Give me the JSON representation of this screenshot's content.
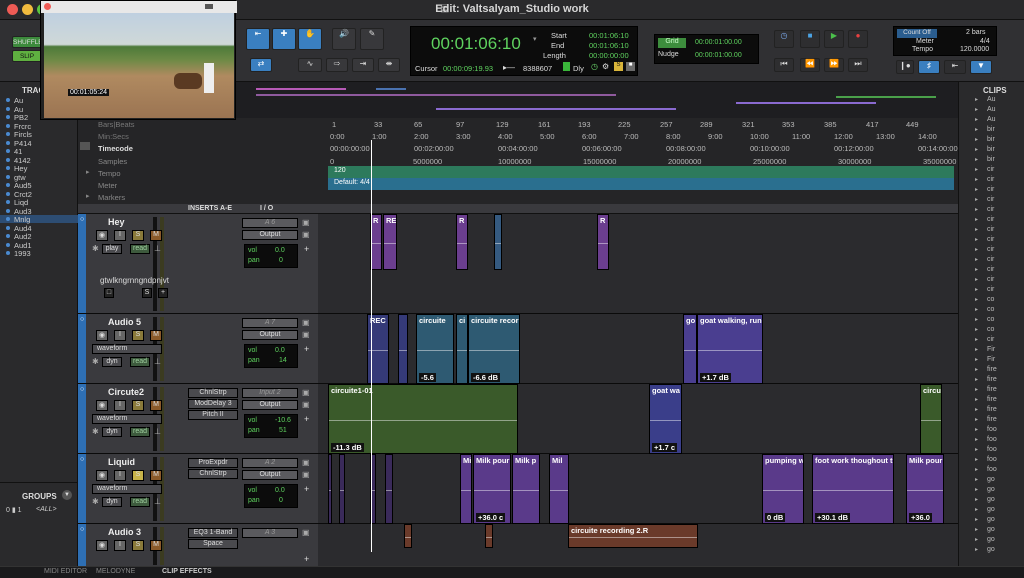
{
  "window": {
    "title": "Edit: Valtsalyam_Studio work"
  },
  "toolbar": {
    "shuffle": "SHUFFLE",
    "slip": "SLIP",
    "main_counter": "00:01:06:10",
    "start_label": "Start",
    "end_label": "End",
    "length_label": "Length",
    "start": "00:01:06:10",
    "end": "00:01:06:10",
    "length": "00:00:00:00",
    "cursor_label": "Cursor",
    "cursor": "00:00:09:19.93",
    "samples": "8388607",
    "dly": "Dly",
    "grid_label": "Grid",
    "nudge_label": "Nudge",
    "grid": "00:00:01:00.00",
    "nudge": "00:00:01:00.00",
    "count_off": "Count Off",
    "meter_label": "Meter",
    "tempo_label": "Tempo",
    "bars": "2 bars",
    "meter": "4/4",
    "tempo": "120.0000"
  },
  "video": {
    "timecode": "00:01:05:24"
  },
  "rulers": {
    "bars_beats": "Bars|Beats",
    "min_secs": "Min:Secs",
    "timecode": "Timecode",
    "samples": "Samples",
    "tempo": "Tempo",
    "meter": "Meter",
    "markers": "Markers",
    "tempo_value": "120",
    "meter_value": "Default: 4/4",
    "bars_ticks": [
      "1",
      "33",
      "65",
      "97",
      "129",
      "161",
      "193",
      "225",
      "257",
      "289",
      "321",
      "353",
      "385",
      "417",
      "449"
    ],
    "min_ticks": [
      "0:00",
      "1:00",
      "2:00",
      "3:00",
      "4:00",
      "5:00",
      "6:00",
      "7:00",
      "8:00",
      "9:00",
      "10:00",
      "11:00",
      "12:00",
      "13:00",
      "14:00"
    ],
    "tc_ticks": [
      "00:00:00:00",
      "00:02:00:00",
      "00:04:00:00",
      "00:06:00:00",
      "00:08:00:00",
      "00:10:00:00",
      "00:12:00:00",
      "00:14:00:00"
    ],
    "sample_ticks": [
      "0",
      "5000000",
      "10000000",
      "15000000",
      "20000000",
      "25000000",
      "30000000",
      "35000000",
      "40000000"
    ]
  },
  "columns": {
    "inserts": "INSERTS A-E",
    "io": "I / O"
  },
  "left_panel": {
    "tracks_title": "TRAC",
    "tracks": [
      "Au",
      "Au",
      "PB2",
      "Frcrc",
      "Fircls",
      "P414",
      "41",
      "4142",
      "Hey",
      "gtw",
      "Aud5",
      "Crct2",
      "Liqd",
      "Aud3",
      "Mnlg",
      "Aud4",
      "Aud2",
      "Aud1",
      "1993"
    ],
    "groups_title": "GROUPS",
    "groups_all": "<ALL>"
  },
  "right_panel": {
    "title": "CLIPS",
    "items": [
      "Au",
      "Au",
      "Au",
      "bir",
      "bir",
      "bir",
      "bir",
      "cir",
      "cir",
      "cir",
      "cir",
      "cir",
      "cir",
      "cir",
      "cir",
      "cir",
      "cir",
      "cir",
      "cir",
      "cir",
      "co",
      "co",
      "co",
      "co",
      "cir",
      "Fir",
      "Fir",
      "fire",
      "fire",
      "fire",
      "fire",
      "fire",
      "fire",
      "foo",
      "foo",
      "foo",
      "foo",
      "foo",
      "go",
      "go",
      "go",
      "go",
      "go",
      "go",
      "go",
      "go"
    ]
  },
  "tracks": [
    {
      "name": "Hey",
      "io": "A 6",
      "output": "Output",
      "vol": "0.0",
      "pan": "0",
      "mode": "play",
      "auto": "read",
      "sub": "gtwlkngrnngndpnjvt"
    },
    {
      "name": "Audio 5",
      "io": "A 7",
      "output": "Output",
      "vol": "0.0",
      "pan": "14",
      "mode": "dyn",
      "auto": "read",
      "view": "waveform"
    },
    {
      "name": "Circute2",
      "io": "Input 2",
      "output": "Output",
      "vol": "-10.6",
      "pan": "51",
      "pan2": "100",
      "mode": "dyn",
      "auto": "read",
      "view": "waveform",
      "inserts": [
        "ChnlStrp",
        "ModDelay 3",
        "Pitch II"
      ]
    },
    {
      "name": "Liquid",
      "io": "A 2",
      "output": "Output",
      "vol": "0.0",
      "pan": "0",
      "mode": "dyn",
      "auto": "read",
      "view": "waveform",
      "inserts": [
        "ProExpdr",
        "ChnlStrp"
      ]
    },
    {
      "name": "Audio 3",
      "io": "A 3",
      "inserts": [
        "EQ3 1-Band",
        "Space"
      ]
    }
  ],
  "clips": {
    "rec1": "R",
    "rec2": "RE",
    "rec3": "R",
    "rec4": "R",
    "a5_rec": "REC",
    "a5_c1": "circuite",
    "a5_c2": "ci",
    "a5_c3": "circuite recor",
    "a5_g1": "go",
    "a5_g2": "goat walking, run",
    "a5_g_db": "+1.7 dB",
    "a5_c_db": "-6.6 dB",
    "a5_c2_db": "-5.6",
    "c2_main": "circuite1-01",
    "c2_main_db": "-11.3 dB",
    "c2_goat": "goat wa",
    "c2_goat_db": "+1.7 c",
    "c2_right": "circuit",
    "lq_mi": "Mi",
    "lq_milk1": "Milk pour",
    "lq_milk2": "Milk p",
    "lq_milk3": "Mil",
    "lq_db1": "+36.0 c",
    "lq_pump": "pumping w",
    "lq_pump_db": "0 dB",
    "lq_foot": "foot work thoughout t",
    "lq_foot_db": "+30.1 dB",
    "lq_milk4": "Milk pour",
    "lq_milk4_db": "+36.0",
    "a3_clip": "circuite recording 2.R"
  },
  "bottom_tabs": [
    "MIDI EDITOR",
    "MELODYNE",
    "CLIP EFFECTS"
  ]
}
